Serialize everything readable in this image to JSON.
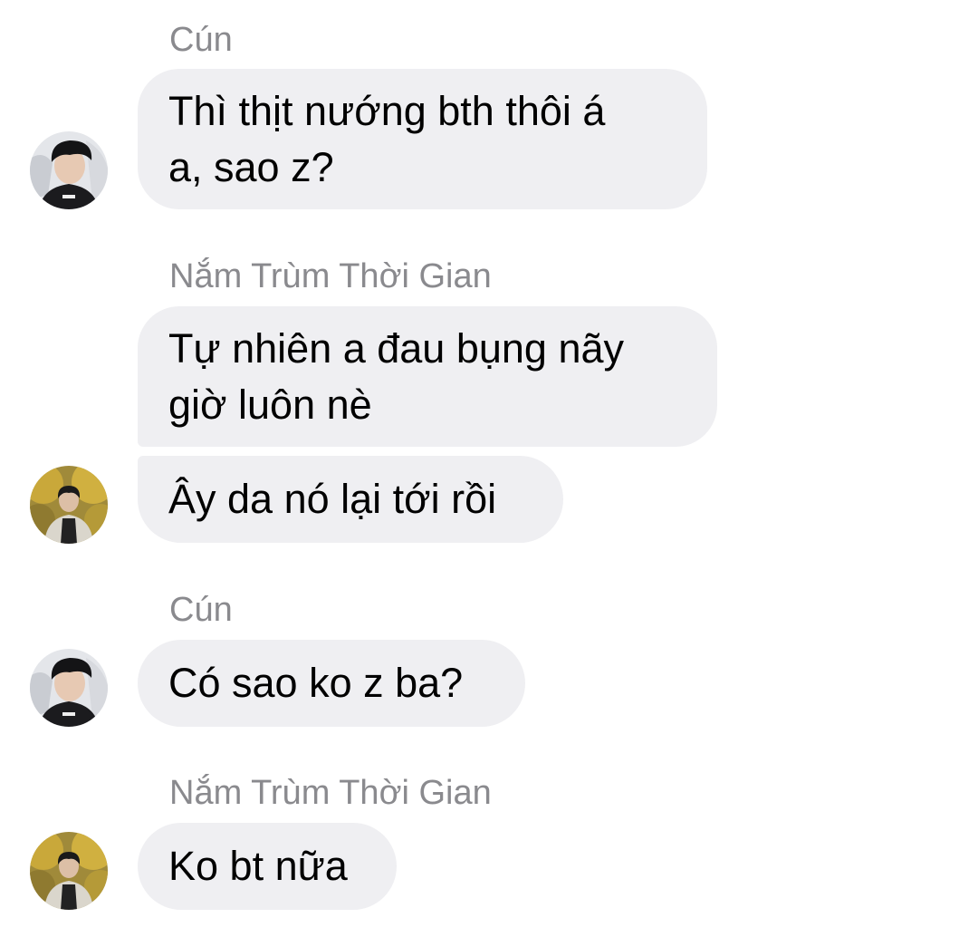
{
  "chat": {
    "messages": [
      {
        "sender": "Cún",
        "lines": [
          "Thì thịt nướng bth thôi á",
          "a, sao z?"
        ]
      },
      {
        "sender": "Nắm Trùm Thời Gian",
        "lines": [
          "Tự nhiên a đau bụng nãy",
          "giờ luôn nè"
        ]
      },
      {
        "lines": [
          "Ây da nó lại tới rồi"
        ]
      },
      {
        "sender": "Cún",
        "lines": [
          "Có sao ko z ba?"
        ]
      },
      {
        "sender": "Nắm Trùm Thời Gian",
        "lines": [
          "Ko bt nữa"
        ]
      }
    ]
  },
  "colors": {
    "bubble": "#efeff2",
    "sender_name": "#8a8a8e",
    "text": "#000000"
  },
  "icons": {
    "avatar_cun": "person-photo-dark-shirt",
    "avatar_nam": "person-photo-autumn-trees"
  }
}
